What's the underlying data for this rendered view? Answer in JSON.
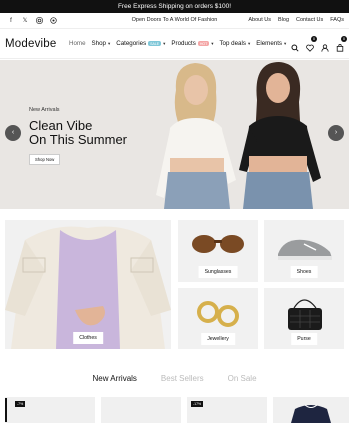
{
  "announcement": "Free Express Shipping on orders $100!",
  "topbar": {
    "center": "Open Doors To A World Of Fashion",
    "links": [
      "About Us",
      "Blog",
      "Contact Us",
      "FAQs"
    ],
    "social_icons": [
      "facebook-icon",
      "x-icon",
      "instagram-icon",
      "pinterest-icon"
    ]
  },
  "header": {
    "logo": "Modevibe",
    "nav": {
      "home": "Home",
      "shop": "Shop",
      "categories": "Categories",
      "categories_badge": "SALE",
      "products": "Products",
      "products_badge": "HOT",
      "top_deals": "Top deals",
      "elements": "Elements"
    },
    "wishlist_count": "0",
    "cart_count": "0"
  },
  "hero": {
    "eyebrow": "New Arrivals",
    "title_line1": "Clean Vibe",
    "title_line2": "On This Summer",
    "button": "Shop Now"
  },
  "categories": {
    "clothes": "Clothes",
    "sunglasses": "Sunglasses",
    "shoes": "Shoes",
    "jewellery": "Jewellery",
    "purse": "Purse"
  },
  "tabs": {
    "new_arrivals": "New Arrivals",
    "best_sellers": "Best Sellers",
    "on_sale": "On Sale"
  },
  "products": {
    "badge1": "-7%",
    "badge2": "-17%"
  },
  "colors": {
    "dark": "#111111",
    "hero_bg": "#e9e6e3",
    "card_bg": "#f1f1f1"
  }
}
